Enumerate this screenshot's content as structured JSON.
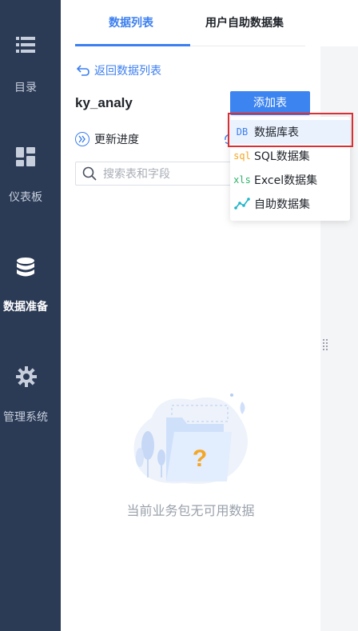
{
  "sidebar": {
    "items": [
      {
        "label": "目录",
        "icon": "list-icon"
      },
      {
        "label": "仪表板",
        "icon": "dashboard-icon"
      },
      {
        "label": "数据准备",
        "icon": "database-icon",
        "active": true
      },
      {
        "label": "管理系统",
        "icon": "gear-icon"
      }
    ]
  },
  "tabs": {
    "active": "数据列表",
    "inactive": "用户自助数据集"
  },
  "back_link": "返回数据列表",
  "dataset_name": "ky_analy",
  "add_button": "添加表",
  "update_progress": "更新进度",
  "search": {
    "placeholder": "搜索表和字段"
  },
  "empty_state": "当前业务包无可用数据",
  "dropdown": {
    "items": [
      {
        "icon_text": "DB",
        "label": "数据库表",
        "color": "#3c7ff0"
      },
      {
        "icon_text": "sql",
        "label": "SQL数据集",
        "color": "#f5a623"
      },
      {
        "icon_text": "xls",
        "label": "Excel数据集",
        "color": "#2fb36b"
      },
      {
        "icon_text": "",
        "label": "自助数据集",
        "color": "#1fb5c8"
      }
    ]
  },
  "colors": {
    "accent": "#3c7ff0",
    "sidebar_bg": "#2b3a55",
    "highlight": "#d93036"
  }
}
